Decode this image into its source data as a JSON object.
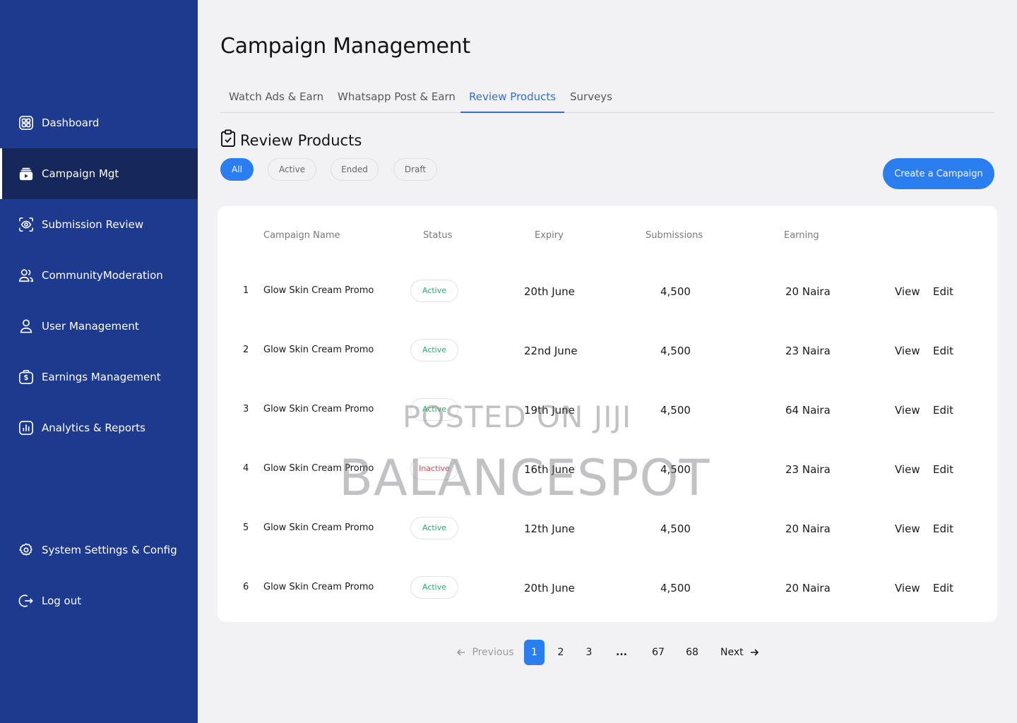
{
  "sidebar": {
    "items": [
      {
        "label": "Dashboard",
        "icon": "grid-icon"
      },
      {
        "label": "Campaign Mgt",
        "icon": "campaign-icon"
      },
      {
        "label": "Submission Review",
        "icon": "eye-scan-icon"
      },
      {
        "label": "CommunityModeration",
        "icon": "users-icon"
      },
      {
        "label": "User Management",
        "icon": "user-icon"
      },
      {
        "label": "Earnings Management",
        "icon": "wallet-icon"
      },
      {
        "label": "Analytics & Reports",
        "icon": "bar-chart-icon"
      },
      {
        "label": "System Settings & Config",
        "icon": "settings-icon"
      },
      {
        "label": "Log out",
        "icon": "logout-icon"
      }
    ],
    "active_index": 1
  },
  "header": {
    "title": "Campaign Management"
  },
  "tabs": [
    {
      "label": "Watch Ads & Earn"
    },
    {
      "label": "Whatsapp Post & Earn"
    },
    {
      "label": "Review Products"
    },
    {
      "label": "Surveys"
    }
  ],
  "active_tab": 2,
  "section": {
    "title": "Review Products"
  },
  "filters": [
    {
      "label": "All"
    },
    {
      "label": "Active"
    },
    {
      "label": "Ended"
    },
    {
      "label": "Draft"
    }
  ],
  "active_filter": 0,
  "create_button": "Create a Campaign",
  "table": {
    "columns": [
      "Campaign Name",
      "Status",
      "Expiry",
      "Submissions",
      "Earning"
    ],
    "actions": {
      "view": "View",
      "edit": "Edit"
    },
    "rows": [
      {
        "num": "1",
        "name": "Glow Skin Cream Promo",
        "status": "Active",
        "expiry": "20th June",
        "submissions": "4,500",
        "earning": "20 Naira"
      },
      {
        "num": "2",
        "name": "Glow Skin Cream Promo",
        "status": "Active",
        "expiry": "22nd June",
        "submissions": "4,500",
        "earning": "23 Naira"
      },
      {
        "num": "3",
        "name": "Glow Skin Cream Promo",
        "status": "Active",
        "expiry": "19th June",
        "submissions": "4,500",
        "earning": "64 Naira"
      },
      {
        "num": "4",
        "name": "Glow Skin Cream Promo",
        "status": "Inactive",
        "expiry": "16th June",
        "submissions": "4,500",
        "earning": "23 Naira"
      },
      {
        "num": "5",
        "name": "Glow Skin Cream Promo",
        "status": "Active",
        "expiry": "12th June",
        "submissions": "4,500",
        "earning": "20 Naira"
      },
      {
        "num": "6",
        "name": "Glow Skin Cream Promo",
        "status": "Active",
        "expiry": "20th June",
        "submissions": "4,500",
        "earning": "20 Naira"
      }
    ]
  },
  "pagination": {
    "previous": "Previous",
    "next": "Next",
    "pages": [
      "1",
      "2",
      "3",
      "...",
      "67",
      "68"
    ],
    "current": "1"
  },
  "watermark": {
    "line1": "POSTED ON JIJI",
    "line2": "BALANCESPOT"
  },
  "colors": {
    "sidebar": "#1e3a8f",
    "sidebar_active": "#16275c",
    "accent": "#2b7ef0",
    "tab_active": "#2f6fd6",
    "status_active": "#2eac6a",
    "status_inactive": "#e0444b"
  }
}
